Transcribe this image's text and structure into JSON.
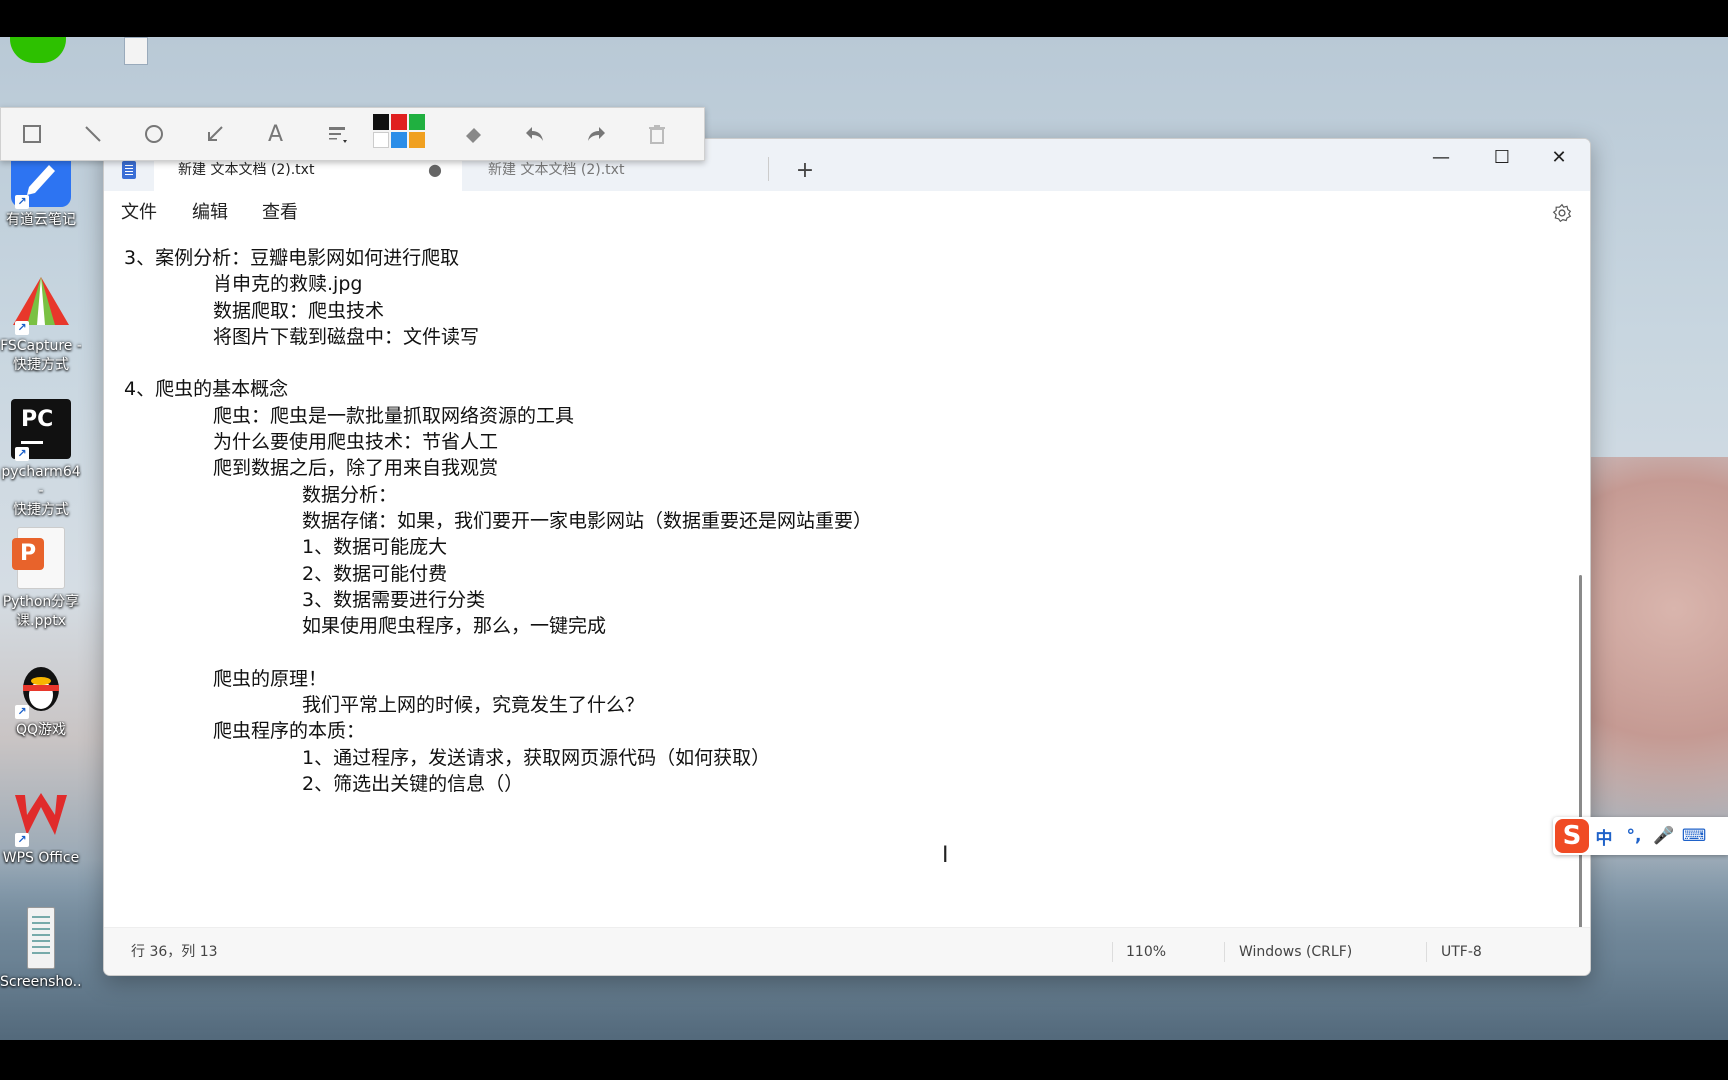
{
  "desktop": {
    "icons": [
      {
        "label": "有道云笔记"
      },
      {
        "label": "FSCapture -\n快捷方式"
      },
      {
        "label": "pycharm64 -\n快捷方式"
      },
      {
        "label": "Python分享\n课.pptx"
      },
      {
        "label": "QQ游戏"
      },
      {
        "label": "WPS Office"
      },
      {
        "label": "Screensho..."
      }
    ]
  },
  "annotation_toolbar": {
    "tools": [
      "rectangle-tool",
      "line-tool",
      "ellipse-tool",
      "arrow-tool",
      "text-tool",
      "line-width-tool",
      "color-palette",
      "eraser-tool",
      "undo-tool",
      "redo-tool",
      "delete-tool"
    ],
    "text_tool_glyph": "A",
    "palette_colors": [
      "#111111",
      "#e02020",
      "#20b040",
      "#ffffff",
      "#2a8de8",
      "#f0a020"
    ]
  },
  "window": {
    "tabs": [
      {
        "label": "新建 文本文档 (2).txt",
        "modified_marker": "●"
      },
      {
        "label": "新建 文本文档 (2).txt"
      }
    ],
    "add_tab": "+",
    "controls": {
      "minimize": "—",
      "maximize": "☐",
      "close": "✕"
    },
    "menu": {
      "file": "文件",
      "edit": "编辑",
      "view": "查看"
    },
    "editor_lines": [
      "3、案例分析：豆瓣电影网如何进行爬取",
      "肖申克的救赎.jpg",
      "数据爬取：爬虫技术",
      "将图片下载到磁盘中：文件读写",
      "",
      "4、爬虫的基本概念",
      "爬虫：爬虫是一款批量抓取网络资源的工具",
      "为什么要使用爬虫技术：节省人工",
      "爬到数据之后，除了用来自我观赏",
      "数据分析：",
      "数据存储：如果，我们要开一家电影网站（数据重要还是网站重要）",
      "1、数据可能庞大",
      "2、数据可能付费",
      "3、数据需要进行分类",
      "如果使用爬虫程序，那么，一键完成",
      "",
      "爬虫的原理！",
      "我们平常上网的时候，究竟发生了什么？",
      "爬虫程序的本质：",
      "1、通过程序，发送请求，获取网页源代码（如何获取）",
      "2、筛选出关键的信息（）"
    ],
    "status": {
      "position": "行 36，列 13",
      "zoom": "110%",
      "line_ending": "Windows (CRLF)",
      "encoding": "UTF-8"
    }
  },
  "ime_bar": {
    "logo": "S",
    "mode": "中",
    "punct": "°,",
    "mic": "🎤",
    "keyboard": "⌨"
  }
}
